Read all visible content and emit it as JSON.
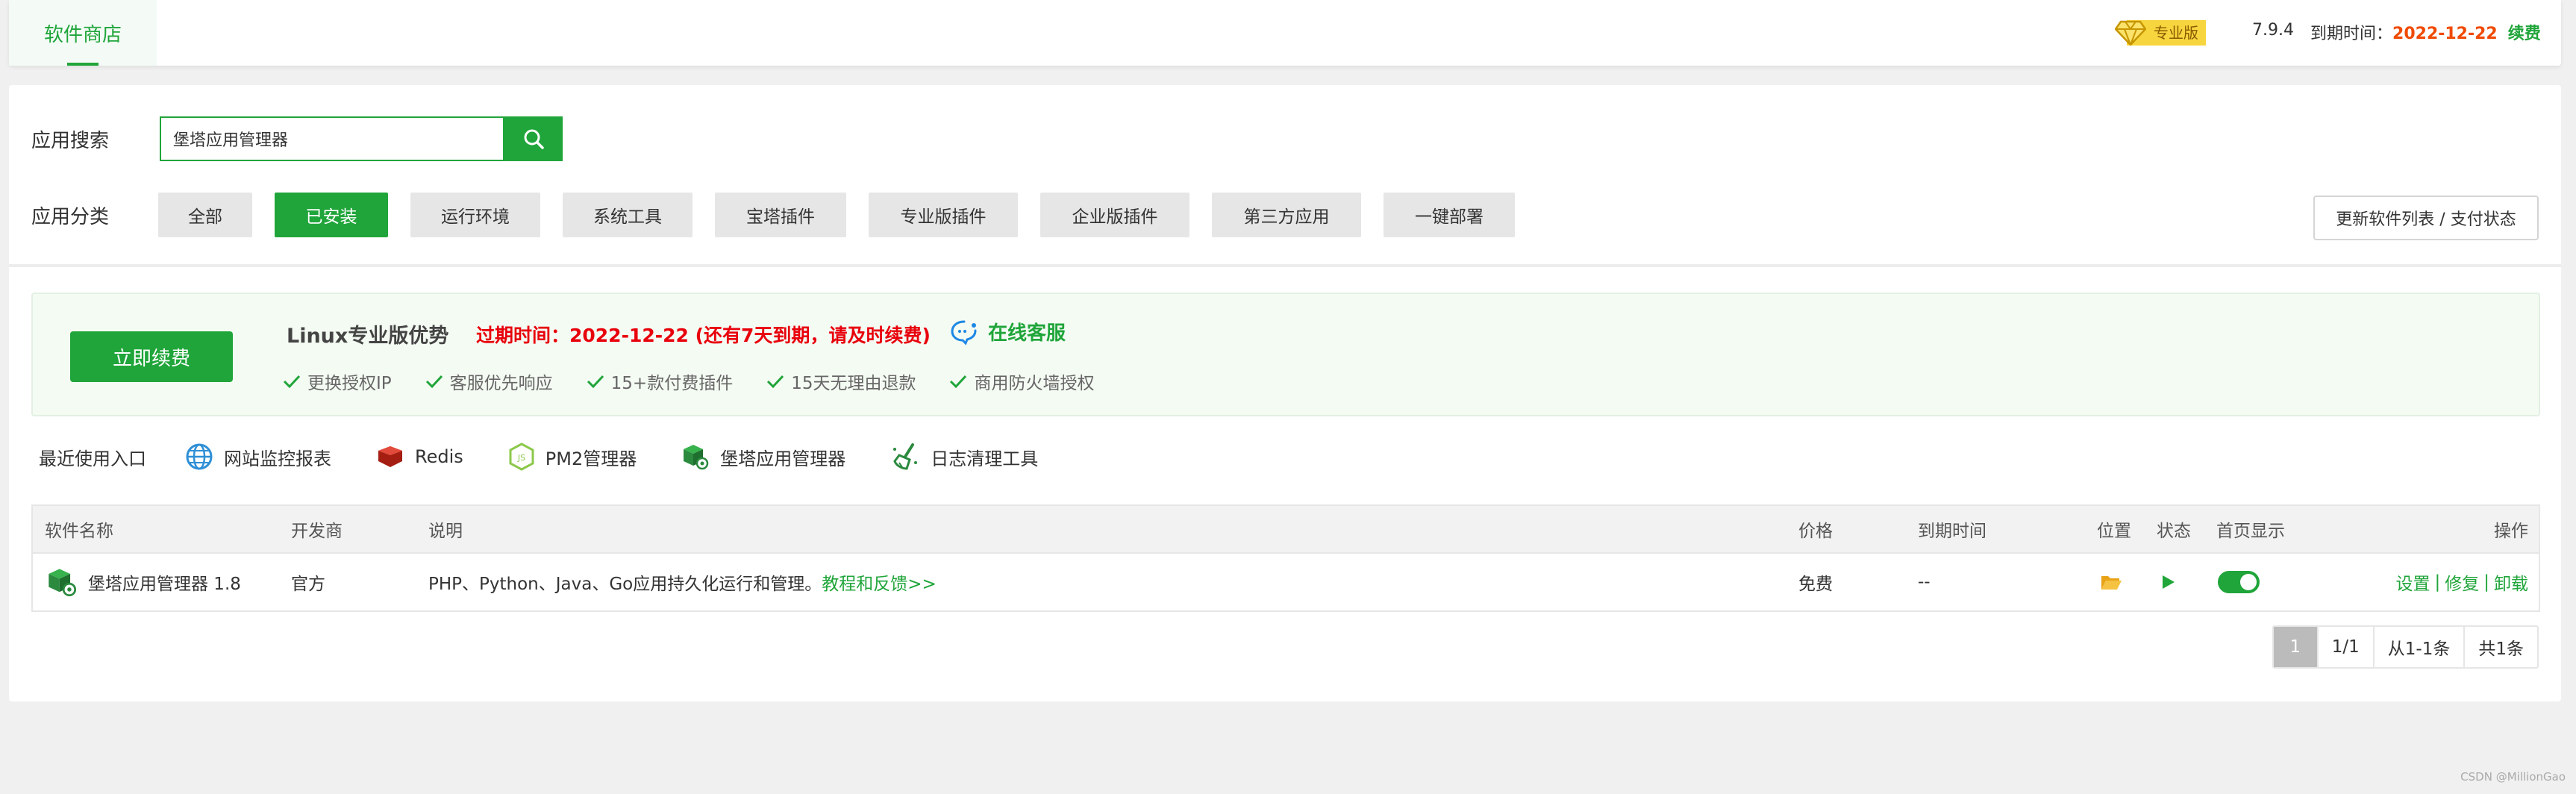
{
  "topbar": {
    "tab": "软件商店",
    "pro_label": "专业版",
    "version": "7.9.4",
    "expire_label": "到期时间：",
    "expire_date": "2022-12-22",
    "renew": "续费"
  },
  "search": {
    "label": "应用搜索",
    "value": "堡塔应用管理器"
  },
  "categories": {
    "label": "应用分类",
    "items": [
      "全部",
      "已安装",
      "运行环境",
      "系统工具",
      "宝塔插件",
      "专业版插件",
      "企业版插件",
      "第三方应用",
      "一键部署"
    ],
    "active": "已安装"
  },
  "refresh_button": "更新软件列表 / 支付状态",
  "promo": {
    "renew_button": "立即续费",
    "title": "Linux专业版优势",
    "expire_text": "过期时间：2022-12-22 (还有7天到期，请及时续费)",
    "service": "在线客服",
    "features": [
      "更换授权IP",
      "客服优先响应",
      "15+款付费插件",
      "15天无理由退款",
      "商用防火墙授权"
    ]
  },
  "recent": {
    "label": "最近使用入口",
    "items": [
      {
        "name": "网站监控报表",
        "icon": "globe-icon"
      },
      {
        "name": "Redis",
        "icon": "redis-icon"
      },
      {
        "name": "PM2管理器",
        "icon": "nodejs-icon"
      },
      {
        "name": "堡塔应用管理器",
        "icon": "cube-icon"
      },
      {
        "name": "日志清理工具",
        "icon": "broom-icon"
      }
    ]
  },
  "table": {
    "headers": {
      "name": "软件名称",
      "dev": "开发商",
      "desc": "说明",
      "price": "价格",
      "expire": "到期时间",
      "location": "位置",
      "status": "状态",
      "home": "首页显示",
      "ops": "操作"
    },
    "rows": [
      {
        "name": "堡塔应用管理器 1.8",
        "dev": "官方",
        "desc": "PHP、Python、Java、Go应用持久化运行和管理。",
        "desc_link": "教程和反馈>>",
        "price": "免费",
        "expire": "--",
        "ops": [
          "设置",
          "修复",
          "卸载"
        ]
      }
    ]
  },
  "pager": {
    "current": "1",
    "total_pages": "1/1",
    "range": "从1-1条",
    "count": "共1条"
  },
  "watermark": "CSDN @MillionGao",
  "colors": {
    "accent": "#20a53a",
    "warning": "#e8000b",
    "expire": "#f04a00"
  }
}
